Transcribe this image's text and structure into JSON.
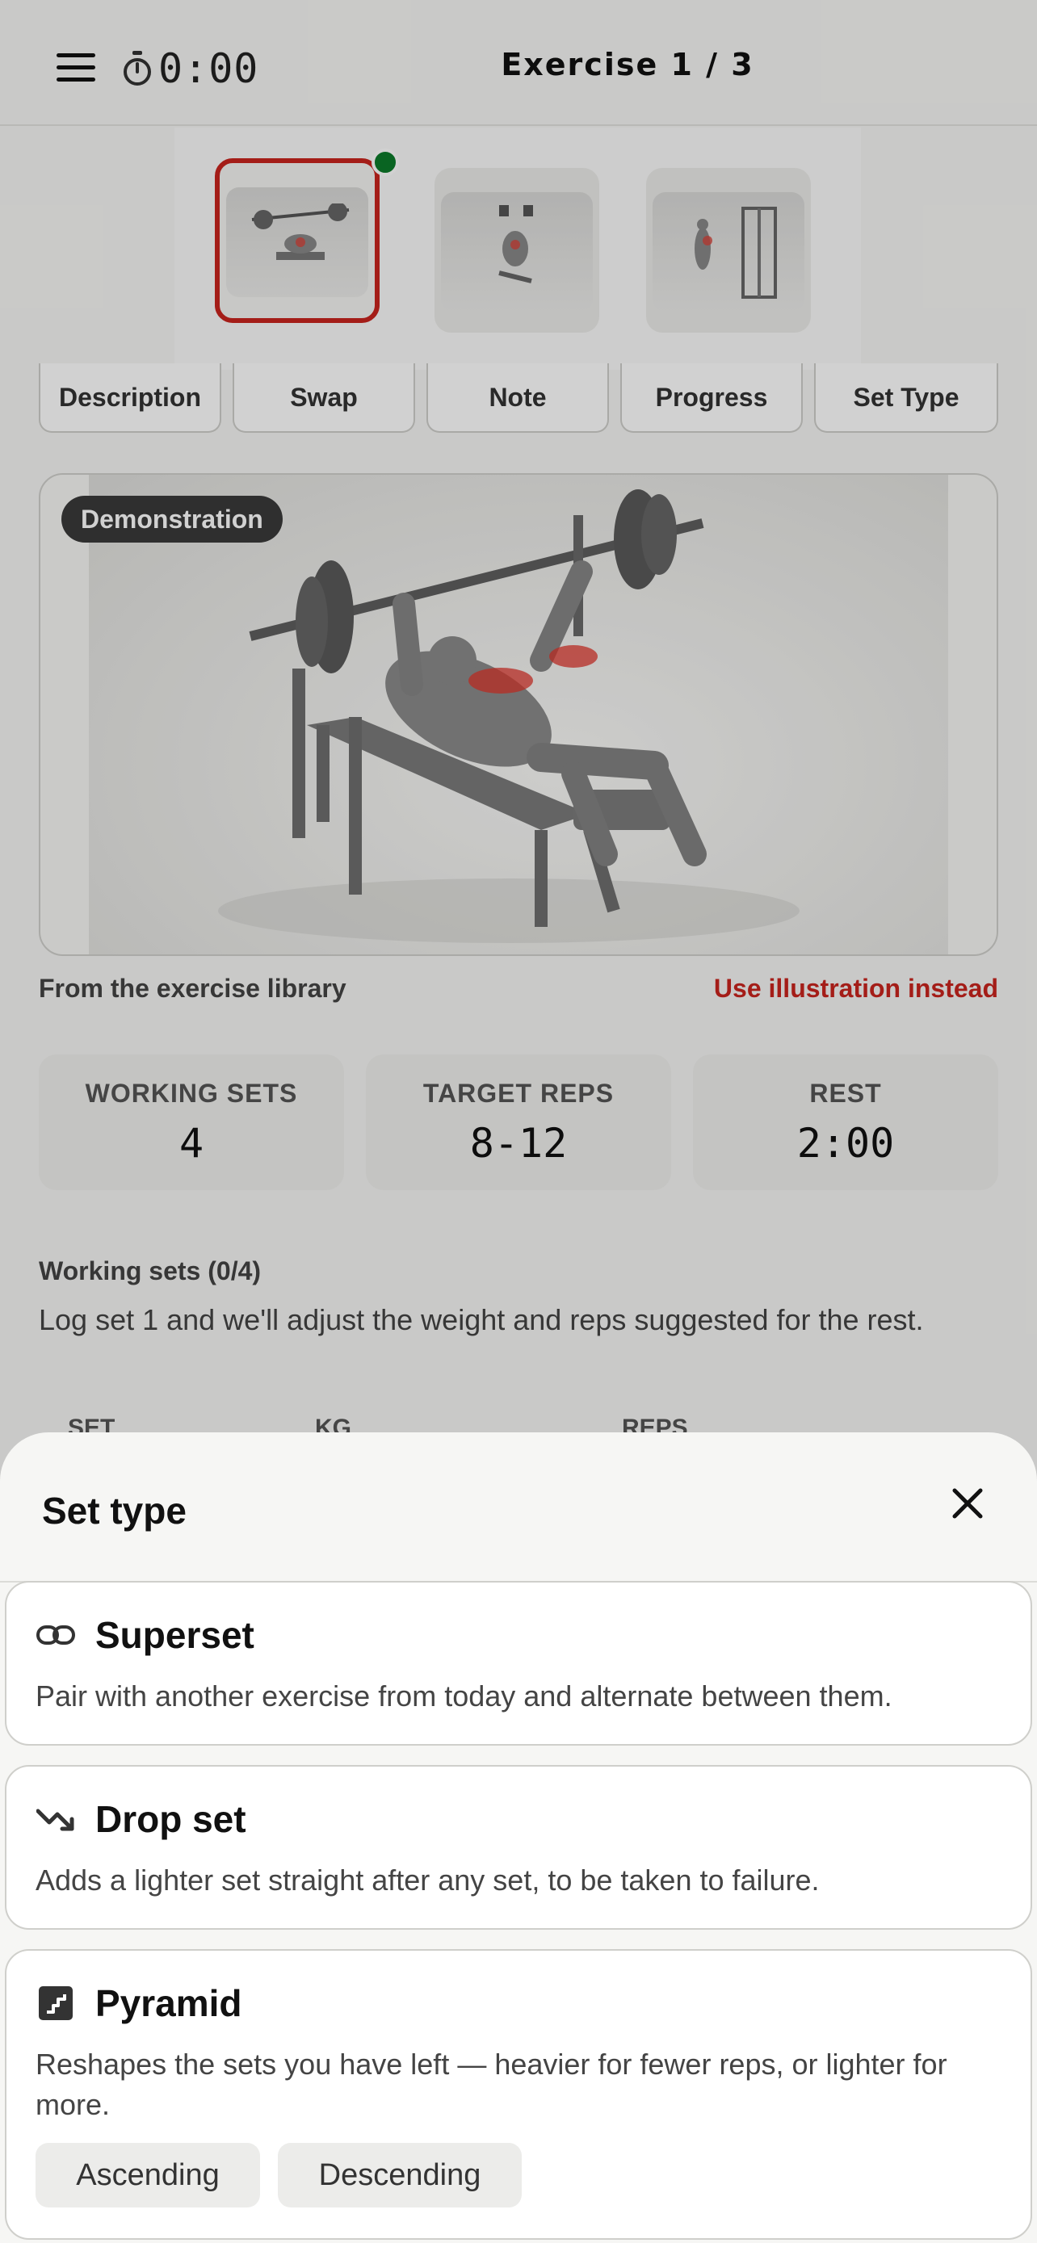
{
  "header": {
    "timer": "0:00",
    "title": "Exercise 1 / 3"
  },
  "thumbnails": [
    {
      "name": "bench-press-thumb",
      "active": true
    },
    {
      "name": "incline-dumbbell-thumb",
      "active": false
    },
    {
      "name": "cable-fly-thumb",
      "active": false
    }
  ],
  "tabs": [
    "Description",
    "Swap",
    "Note",
    "Progress",
    "Set Type"
  ],
  "demo": {
    "badge": "Demonstration"
  },
  "library": {
    "source": "From the exercise library",
    "link": "Use illustration instead"
  },
  "stats": [
    {
      "label": "WORKING SETS",
      "value": "4"
    },
    {
      "label": "TARGET REPS",
      "value": "8-12"
    },
    {
      "label": "REST",
      "value": "2:00"
    }
  ],
  "working_sets": {
    "title": "Working sets (0/4)",
    "description": "Log set 1 and we'll adjust the weight and reps suggested for the rest.",
    "columns": [
      "SET",
      "KG",
      "REPS"
    ]
  },
  "sheet": {
    "title": "Set type",
    "options": [
      {
        "icon": "link-icon",
        "title": "Superset",
        "description": "Pair with another exercise from today and alternate between them."
      },
      {
        "icon": "trending-down-icon",
        "title": "Drop set",
        "description": "Adds a lighter set straight after any set, to be taken to failure."
      },
      {
        "icon": "stairs-icon",
        "title": "Pyramid",
        "description": "Reshapes the sets you have left — heavier for fewer reps, or lighter for more."
      }
    ],
    "pyramid_buttons": [
      "Ascending",
      "Descending"
    ]
  },
  "colors": {
    "accent_red": "#c8241e",
    "active_dot": "#0c7a2a"
  }
}
